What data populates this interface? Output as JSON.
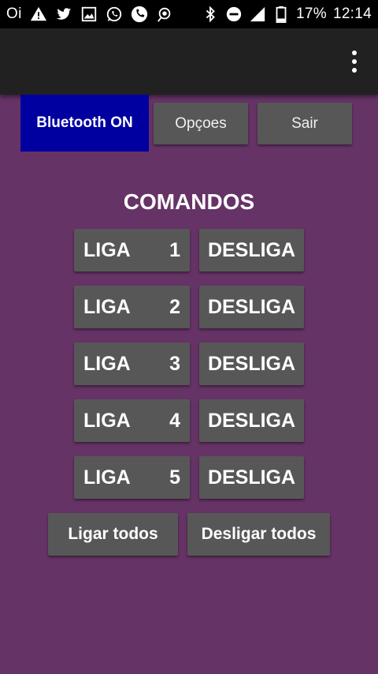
{
  "statusbar": {
    "carrier": "Oi",
    "battery": "17%",
    "time": "12:14",
    "icons": [
      "warning-icon",
      "twitter-icon",
      "image-icon",
      "whatsapp-icon",
      "phone-icon",
      "cast-icon",
      "bluetooth-icon",
      "do-not-disturb-icon",
      "signal-icon",
      "battery-icon"
    ]
  },
  "appbar": {
    "menu_icon": "overflow-menu-icon"
  },
  "top_buttons": {
    "bluetooth": "Bluetooth ON",
    "options": "Opçoes",
    "exit": "Sair"
  },
  "title": "COMANDOS",
  "commands": [
    {
      "on": "LIGA",
      "num": "1",
      "off": "DESLIGA"
    },
    {
      "on": "LIGA",
      "num": "2",
      "off": "DESLIGA"
    },
    {
      "on": "LIGA",
      "num": "3",
      "off": "DESLIGA"
    },
    {
      "on": "LIGA",
      "num": "4",
      "off": "DESLIGA"
    },
    {
      "on": "LIGA",
      "num": "5",
      "off": "DESLIGA"
    }
  ],
  "all_buttons": {
    "on_all": "Ligar todos",
    "off_all": "Desligar todos"
  },
  "colors": {
    "background": "#663366",
    "appbar": "#212121",
    "button": "#575757",
    "bluetooth_button": "#0000a0"
  }
}
